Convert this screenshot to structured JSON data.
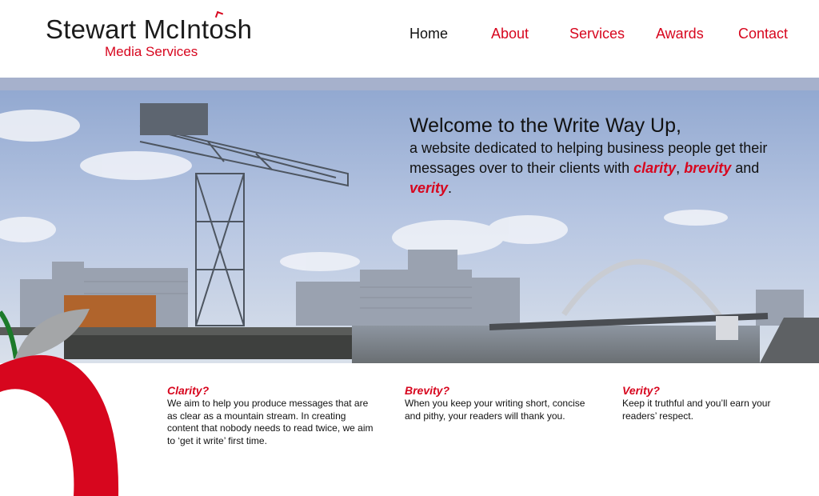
{
  "brand": {
    "name": "Stewart McIntosh",
    "name_before_o": "Stewart McInt",
    "name_o": "o",
    "name_after_o": "sh",
    "subtitle": "Media Services",
    "accent_color": "#d7061e"
  },
  "nav": {
    "items": [
      {
        "label": "Home",
        "active": true
      },
      {
        "label": "About",
        "active": false
      },
      {
        "label": "Services",
        "active": false
      },
      {
        "label": "Awards",
        "active": false
      },
      {
        "label": "Contact",
        "active": false
      }
    ]
  },
  "hero": {
    "title": "Welcome to the Write Way Up,",
    "body_before": "a website dedicated to helping business people get their messages over to their clients with ",
    "word1": "clarity",
    "sep1": ", ",
    "word2": "brevity",
    "sep2": " and ",
    "word3": "verity",
    "body_after": "."
  },
  "features": [
    {
      "heading": "Clarity?",
      "text": "We aim to help you produce messages that are as clear as a mountain stream. In creating content that nobody needs to read twice, we aim to ‘get it write’ first time."
    },
    {
      "heading": "Brevity?",
      "text": "When you keep your writing short, concise and pithy, your readers will thank you."
    },
    {
      "heading": "Verity?",
      "text": "Keep it truthful and you’ll earn your readers’ respect."
    }
  ],
  "icons": {
    "logo_apple": "apple-icon",
    "decorative_apple": "apple-icon"
  }
}
